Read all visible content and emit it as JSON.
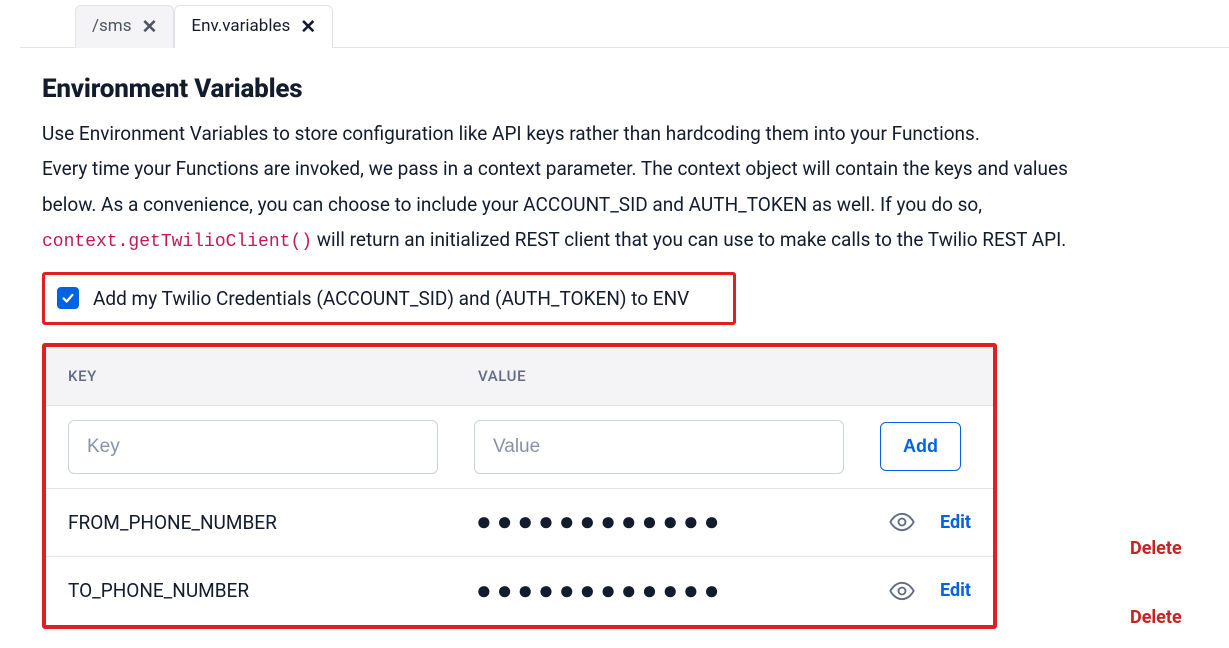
{
  "tabs": {
    "sms": {
      "label": "/sms"
    },
    "env": {
      "label": "Env.variables"
    }
  },
  "page_title": "Environment Variables",
  "description": {
    "line1": "Use Environment Variables to store configuration like API keys rather than hardcoding them into your Functions.",
    "line2_a": "Every time your Functions are invoked, we pass in a context parameter. The context object will contain the keys and values",
    "line2_b": "below. As a convenience, you can choose to include your ACCOUNT_SID and AUTH_TOKEN as well. If you do so,",
    "code": "context.getTwilioClient()",
    "line3": " will return an initialized REST client that you can use to make calls to the Twilio REST API."
  },
  "credentials_checkbox": {
    "checked": true,
    "label": "Add my Twilio Credentials (ACCOUNT_SID) and (AUTH_TOKEN) to ENV"
  },
  "table": {
    "headers": {
      "key": "KEY",
      "value": "VALUE"
    },
    "new_row": {
      "key_placeholder": "Key",
      "value_placeholder": "Value",
      "add_label": "Add"
    },
    "rows": [
      {
        "key": "FROM_PHONE_NUMBER",
        "value_masked": "●●●●●●●●●●●●",
        "edit": "Edit",
        "delete": "Delete"
      },
      {
        "key": "TO_PHONE_NUMBER",
        "value_masked": "●●●●●●●●●●●●",
        "edit": "Edit",
        "delete": "Delete"
      }
    ]
  }
}
